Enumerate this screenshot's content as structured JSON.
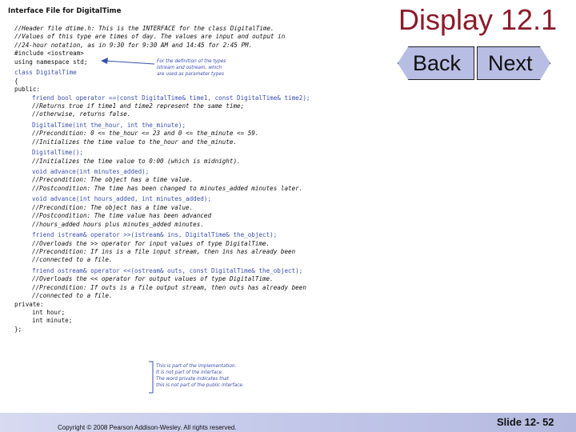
{
  "slide": {
    "title": "Display 12.1",
    "back_label": "Back",
    "next_label": "Next",
    "copyright": "Copyright © 2008 Pearson Addison-Wesley. All rights reserved.",
    "slide_number": "Slide 12- 52"
  },
  "figure": {
    "title": "Interface File for DigitalTime",
    "code_lines": [
      {
        "text": "//Header file dtime.h: This is the INTERFACE for the class DigitalTime.",
        "style": "c"
      },
      {
        "text": "//Values of this type are times of day. The values are input and output in",
        "style": "c"
      },
      {
        "text": "//24-hour notation, as in 9:30 for 9:30 AM and 14:45 for 2:45 PM.",
        "style": "c"
      },
      {
        "text": "#include <iostream>",
        "style": "k"
      },
      {
        "text": "using namespace std;",
        "style": "k"
      },
      {
        "text": "",
        "style": "blank"
      },
      {
        "text": "class DigitalTime",
        "style": "b"
      },
      {
        "text": "{",
        "style": "k"
      },
      {
        "text": "public:",
        "style": "k"
      },
      {
        "text": "friend bool operator ==(const DigitalTime& time1, const DigitalTime& time2);",
        "style": "b",
        "indent": true
      },
      {
        "text": "//Returns true if time1 and time2 represent the same time;",
        "style": "c",
        "indent": true
      },
      {
        "text": "//otherwise, returns false.",
        "style": "c",
        "indent": true
      },
      {
        "text": "",
        "style": "blank"
      },
      {
        "text": "DigitalTime(int the_hour, int the_minute);",
        "style": "b",
        "indent": true
      },
      {
        "text": "//Precondition: 0 <= the_hour <= 23 and 0 <= the_minute <= 59.",
        "style": "c",
        "indent": true
      },
      {
        "text": "//Initializes the time value to the_hour and the_minute.",
        "style": "c",
        "indent": true
      },
      {
        "text": "",
        "style": "blank"
      },
      {
        "text": "DigitalTime();",
        "style": "b",
        "indent": true
      },
      {
        "text": "//Initializes the time value to 0:00 (which is midnight).",
        "style": "c",
        "indent": true
      },
      {
        "text": "",
        "style": "blank"
      },
      {
        "text": "void advance(int minutes_added);",
        "style": "b",
        "indent": true
      },
      {
        "text": "//Precondition: The object has a time value.",
        "style": "c",
        "indent": true
      },
      {
        "text": "//Postcondition: The time has been changed to minutes_added minutes later.",
        "style": "c",
        "indent": true
      },
      {
        "text": "",
        "style": "blank"
      },
      {
        "text": "void advance(int hours_added, int minutes_added);",
        "style": "b",
        "indent": true
      },
      {
        "text": "//Precondition: The object has a time value.",
        "style": "c",
        "indent": true
      },
      {
        "text": "//Postcondition: The time value has been advanced",
        "style": "c",
        "indent": true
      },
      {
        "text": "//hours_added hours plus minutes_added minutes.",
        "style": "c",
        "indent": true
      },
      {
        "text": "",
        "style": "blank"
      },
      {
        "text": "friend istream& operator >>(istream& ins, DigitalTime& the_object);",
        "style": "b",
        "indent": true
      },
      {
        "text": "//Overloads the >> operator for input values of type DigitalTime.",
        "style": "c",
        "indent": true
      },
      {
        "text": "//Precondition: If ins is a file input stream, then ins has already been",
        "style": "c",
        "indent": true
      },
      {
        "text": "//connected to a file.",
        "style": "c",
        "indent": true
      },
      {
        "text": "",
        "style": "blank"
      },
      {
        "text": "friend ostream& operator <<(ostream& outs, const DigitalTime& the_object);",
        "style": "b",
        "indent": true
      },
      {
        "text": "//Overloads the << operator for output values of type DigitalTime.",
        "style": "c",
        "indent": true
      },
      {
        "text": "//Precondition: If outs is a file output stream, then outs has already been",
        "style": "c",
        "indent": true
      },
      {
        "text": "//connected to a file.",
        "style": "c",
        "indent": true
      },
      {
        "text": "private:",
        "style": "k"
      },
      {
        "text": "int hour;",
        "style": "k",
        "indent": true
      },
      {
        "text": "int minute;",
        "style": "k",
        "indent": true
      },
      {
        "text": "};",
        "style": "k"
      }
    ],
    "annotations": {
      "iostream_note": [
        "For the definition of the types",
        "istream and ostream, which",
        "are used as parameter types"
      ],
      "private_note": [
        "This is part of the implementation.",
        "It is not part of the interface.",
        "The word private indicates that",
        "this is not part of the public interface."
      ]
    }
  },
  "colors": {
    "title": "#8b1a2a",
    "nav_button": "#b8bde4",
    "footer": "#c3c8ea",
    "code_blue": "#3a4fb0"
  }
}
